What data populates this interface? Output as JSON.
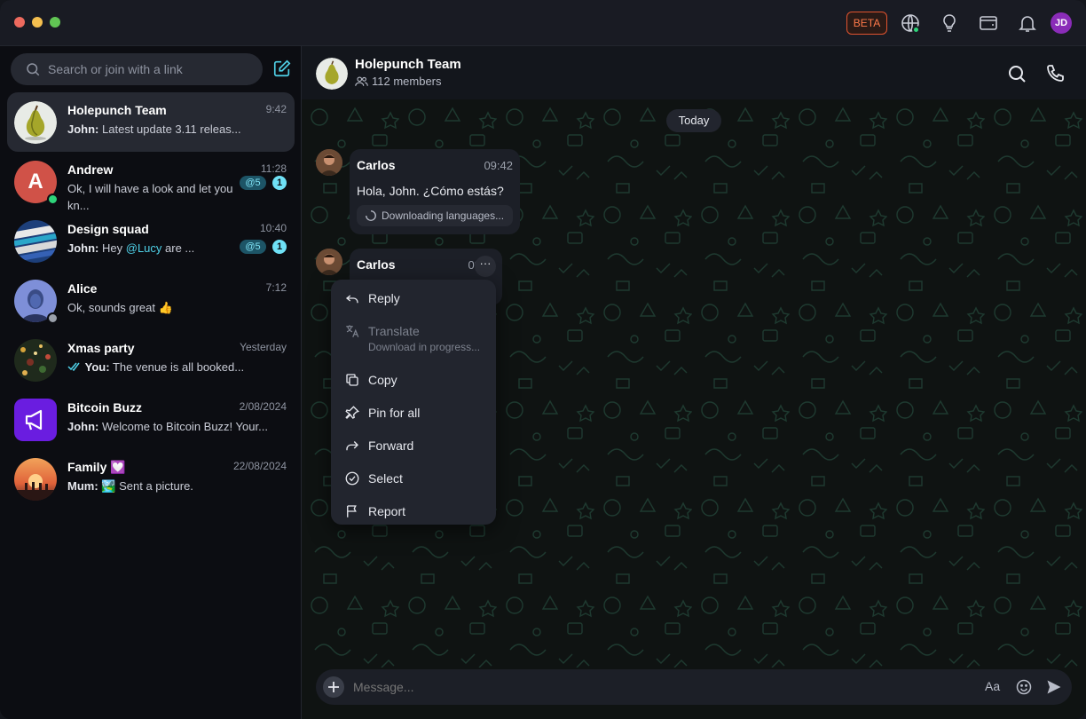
{
  "titlebar": {
    "beta_label": "BETA",
    "user_initials": "JD",
    "icons": [
      "globe-icon",
      "lightbulb-icon",
      "wallet-icon",
      "bell-icon"
    ]
  },
  "sidebar": {
    "search_placeholder": "Search or join with a link",
    "chats": [
      {
        "name": "Holepunch Team",
        "time": "9:42",
        "sender": "John:",
        "preview": "Latest update 3.11 releas..."
      },
      {
        "name": "Andrew",
        "time": "11:28",
        "sender": "",
        "preview": "Ok, I will have a look and let you kn...",
        "avatar_letter": "A",
        "mentions": "@5",
        "unread": "1"
      },
      {
        "name": "Design squad",
        "time": "10:40",
        "sender": "John:",
        "preview_pre": "Hey ",
        "mention": "@Lucy",
        "preview_post": " are ...",
        "mentions": "@5",
        "unread": "1"
      },
      {
        "name": "Alice",
        "time": "7:12",
        "sender": "",
        "preview": "Ok, sounds great 👍"
      },
      {
        "name": "Xmas party",
        "time": "Yesterday",
        "sender": "You:",
        "preview": "The venue is all booked..."
      },
      {
        "name": "Bitcoin Buzz",
        "time": "2/08/2024",
        "sender": "John:",
        "preview": "Welcome to Bitcoin Buzz! Your..."
      },
      {
        "name": "Family 💟",
        "time": "22/08/2024",
        "sender": "Mum:",
        "preview": "🏞️ Sent a picture."
      }
    ]
  },
  "conversation": {
    "title": "Holepunch Team",
    "members": "112 members",
    "date_divider": "Today",
    "messages": [
      {
        "sender": "Carlos",
        "time": "09:42",
        "text": "Hola, John. ¿Cómo estás?",
        "status": "Downloading languages..."
      },
      {
        "sender": "Carlos",
        "time": "09"
      }
    ],
    "more_label": "···"
  },
  "context_menu": {
    "items": [
      {
        "label": "Reply",
        "icon": "reply-icon"
      },
      {
        "label": "Translate",
        "sub": "Download in progress...",
        "icon": "translate-icon",
        "disabled": true
      },
      {
        "label": "Copy",
        "icon": "copy-icon"
      },
      {
        "label": "Pin for all",
        "icon": "pin-icon"
      },
      {
        "label": "Forward",
        "icon": "forward-icon"
      },
      {
        "label": "Select",
        "icon": "check-circle-icon"
      },
      {
        "label": "Report",
        "icon": "flag-icon"
      }
    ]
  },
  "composer": {
    "placeholder": "Message...",
    "format_label": "Aa"
  },
  "colors": {
    "accent": "#4fd1e8",
    "beta": "#ff7a4a",
    "online": "#2ed47a",
    "user_avatar": "#8a2cb8"
  }
}
